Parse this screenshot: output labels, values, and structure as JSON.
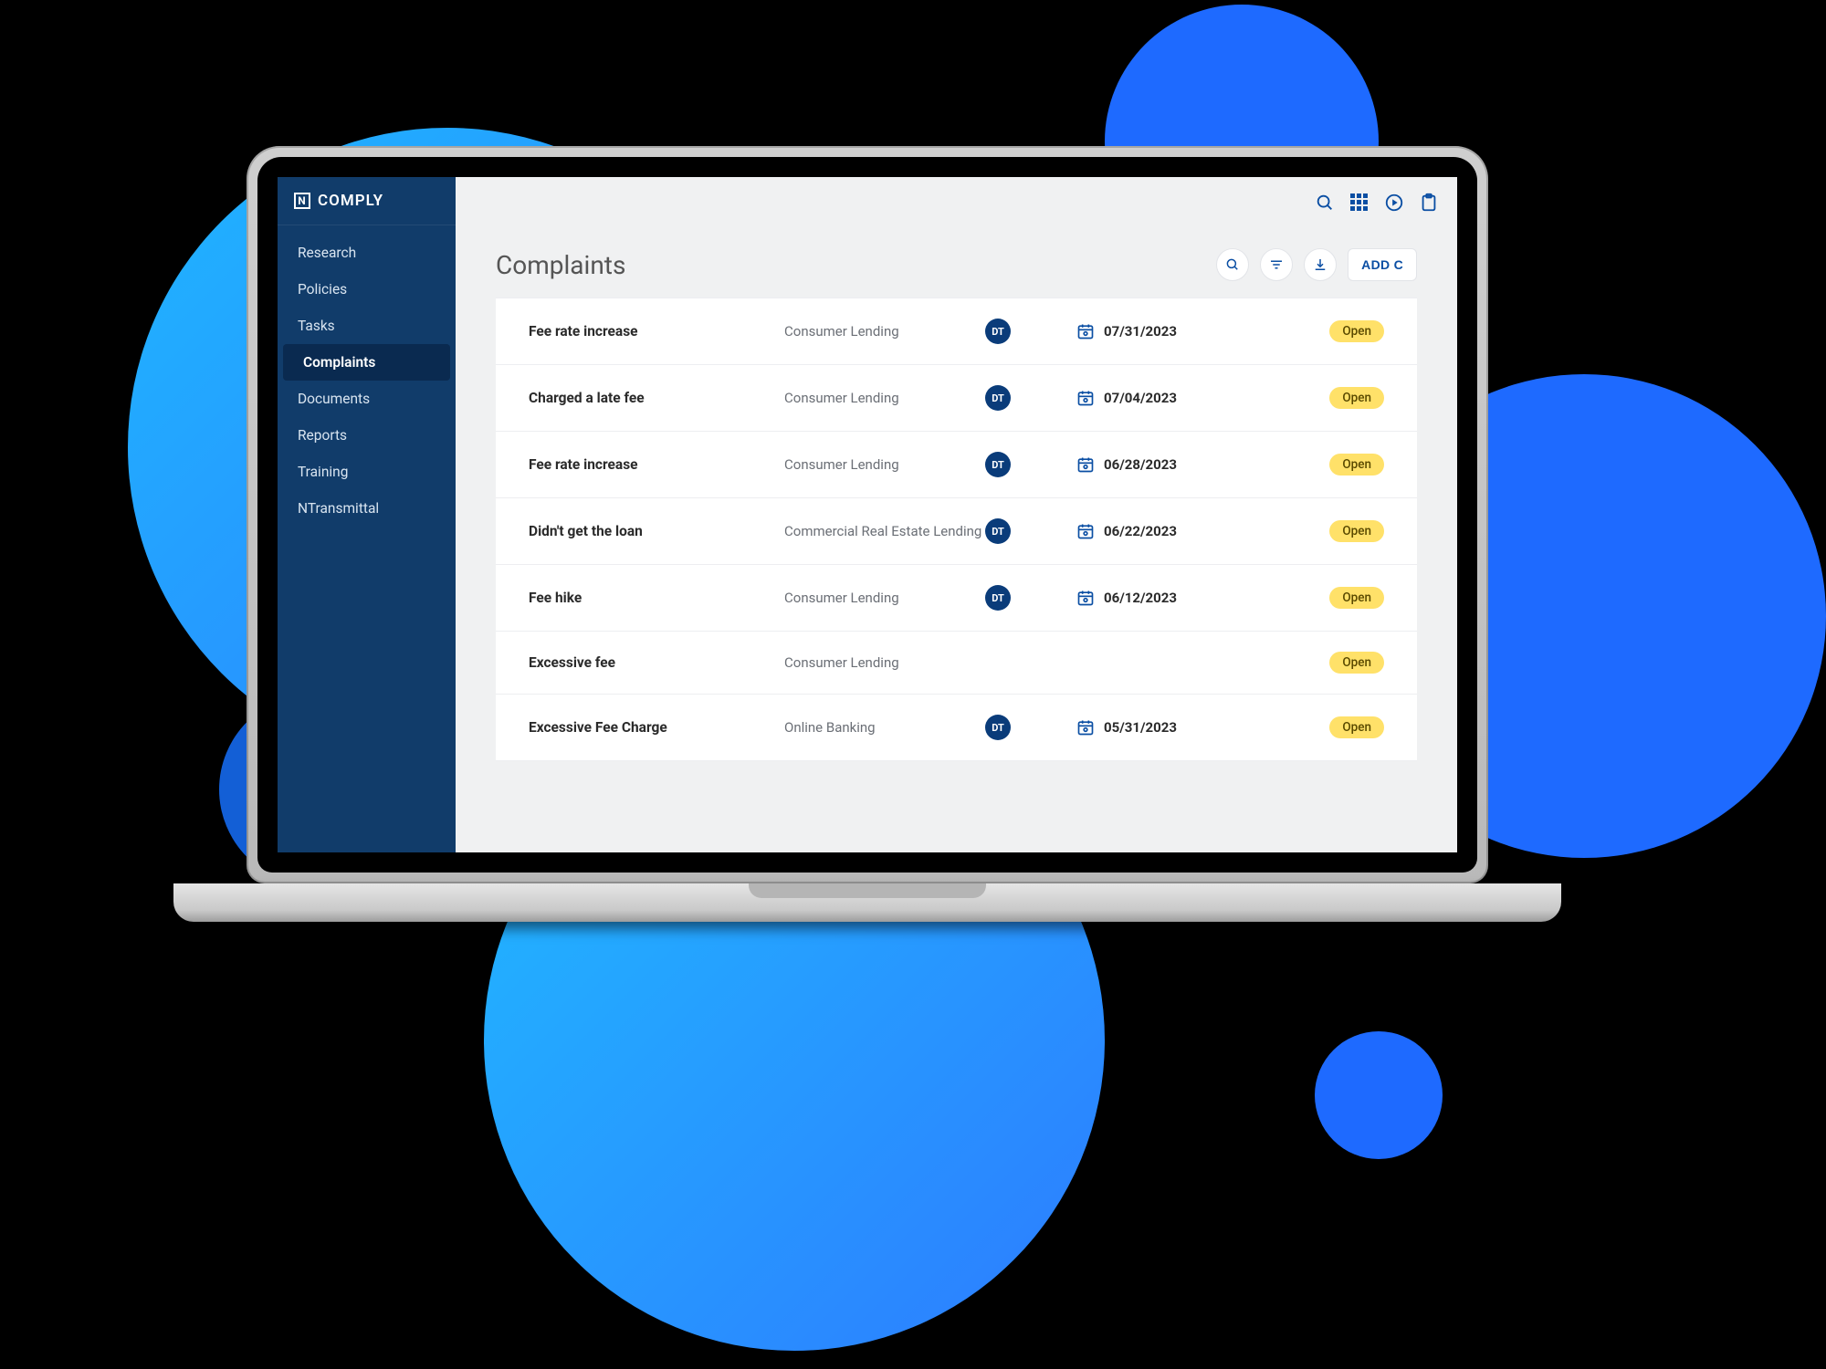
{
  "brand": {
    "name": "COMPLY",
    "logo_letter": "N"
  },
  "sidebar": {
    "items": [
      {
        "label": "Research"
      },
      {
        "label": "Policies"
      },
      {
        "label": "Tasks"
      },
      {
        "label": "Complaints",
        "active": true
      },
      {
        "label": "Documents"
      },
      {
        "label": "Reports"
      },
      {
        "label": "Training"
      },
      {
        "label": "NTransmittal"
      }
    ]
  },
  "page": {
    "title": "Complaints",
    "add_button_label": "ADD C"
  },
  "complaints": [
    {
      "title": "Fee rate increase",
      "category": "Consumer Lending",
      "assignee": "DT",
      "date": "07/31/2023",
      "status": "Open"
    },
    {
      "title": "Charged a late fee",
      "category": "Consumer Lending",
      "assignee": "DT",
      "date": "07/04/2023",
      "status": "Open"
    },
    {
      "title": "Fee rate increase",
      "category": "Consumer Lending",
      "assignee": "DT",
      "date": "06/28/2023",
      "status": "Open"
    },
    {
      "title": "Didn't get the loan",
      "category": "Commercial Real Estate Lending",
      "assignee": "DT",
      "date": "06/22/2023",
      "status": "Open"
    },
    {
      "title": "Fee hike",
      "category": "Consumer Lending",
      "assignee": "DT",
      "date": "06/12/2023",
      "status": "Open"
    },
    {
      "title": "Excessive fee",
      "category": "Consumer Lending",
      "assignee": "",
      "date": "",
      "status": "Open"
    },
    {
      "title": "Excessive Fee Charge",
      "category": "Online Banking",
      "assignee": "DT",
      "date": "05/31/2023",
      "status": "Open"
    }
  ]
}
